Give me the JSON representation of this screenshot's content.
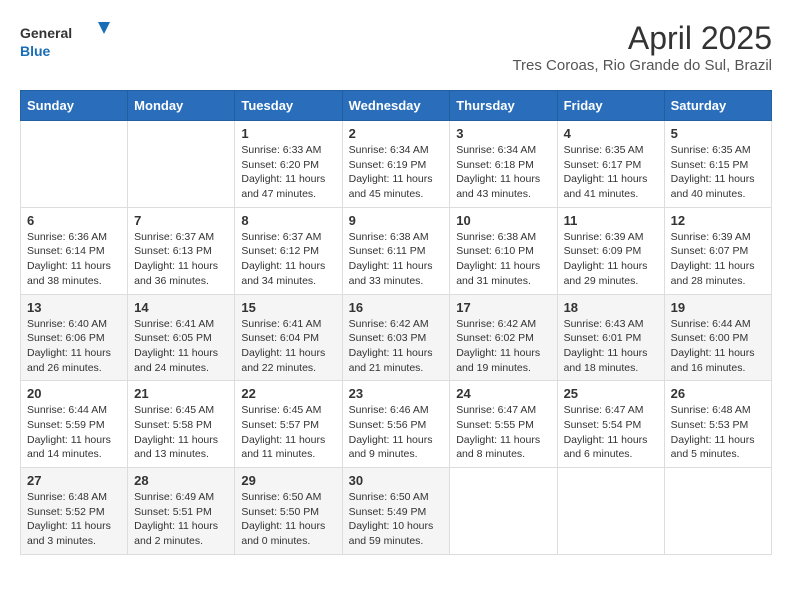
{
  "header": {
    "logo_general": "General",
    "logo_blue": "Blue",
    "month_title": "April 2025",
    "location": "Tres Coroas, Rio Grande do Sul, Brazil"
  },
  "calendar": {
    "days_of_week": [
      "Sunday",
      "Monday",
      "Tuesday",
      "Wednesday",
      "Thursday",
      "Friday",
      "Saturday"
    ],
    "weeks": [
      [
        {
          "day": "",
          "info": ""
        },
        {
          "day": "",
          "info": ""
        },
        {
          "day": "1",
          "info": "Sunrise: 6:33 AM\nSunset: 6:20 PM\nDaylight: 11 hours and 47 minutes."
        },
        {
          "day": "2",
          "info": "Sunrise: 6:34 AM\nSunset: 6:19 PM\nDaylight: 11 hours and 45 minutes."
        },
        {
          "day": "3",
          "info": "Sunrise: 6:34 AM\nSunset: 6:18 PM\nDaylight: 11 hours and 43 minutes."
        },
        {
          "day": "4",
          "info": "Sunrise: 6:35 AM\nSunset: 6:17 PM\nDaylight: 11 hours and 41 minutes."
        },
        {
          "day": "5",
          "info": "Sunrise: 6:35 AM\nSunset: 6:15 PM\nDaylight: 11 hours and 40 minutes."
        }
      ],
      [
        {
          "day": "6",
          "info": "Sunrise: 6:36 AM\nSunset: 6:14 PM\nDaylight: 11 hours and 38 minutes."
        },
        {
          "day": "7",
          "info": "Sunrise: 6:37 AM\nSunset: 6:13 PM\nDaylight: 11 hours and 36 minutes."
        },
        {
          "day": "8",
          "info": "Sunrise: 6:37 AM\nSunset: 6:12 PM\nDaylight: 11 hours and 34 minutes."
        },
        {
          "day": "9",
          "info": "Sunrise: 6:38 AM\nSunset: 6:11 PM\nDaylight: 11 hours and 33 minutes."
        },
        {
          "day": "10",
          "info": "Sunrise: 6:38 AM\nSunset: 6:10 PM\nDaylight: 11 hours and 31 minutes."
        },
        {
          "day": "11",
          "info": "Sunrise: 6:39 AM\nSunset: 6:09 PM\nDaylight: 11 hours and 29 minutes."
        },
        {
          "day": "12",
          "info": "Sunrise: 6:39 AM\nSunset: 6:07 PM\nDaylight: 11 hours and 28 minutes."
        }
      ],
      [
        {
          "day": "13",
          "info": "Sunrise: 6:40 AM\nSunset: 6:06 PM\nDaylight: 11 hours and 26 minutes."
        },
        {
          "day": "14",
          "info": "Sunrise: 6:41 AM\nSunset: 6:05 PM\nDaylight: 11 hours and 24 minutes."
        },
        {
          "day": "15",
          "info": "Sunrise: 6:41 AM\nSunset: 6:04 PM\nDaylight: 11 hours and 22 minutes."
        },
        {
          "day": "16",
          "info": "Sunrise: 6:42 AM\nSunset: 6:03 PM\nDaylight: 11 hours and 21 minutes."
        },
        {
          "day": "17",
          "info": "Sunrise: 6:42 AM\nSunset: 6:02 PM\nDaylight: 11 hours and 19 minutes."
        },
        {
          "day": "18",
          "info": "Sunrise: 6:43 AM\nSunset: 6:01 PM\nDaylight: 11 hours and 18 minutes."
        },
        {
          "day": "19",
          "info": "Sunrise: 6:44 AM\nSunset: 6:00 PM\nDaylight: 11 hours and 16 minutes."
        }
      ],
      [
        {
          "day": "20",
          "info": "Sunrise: 6:44 AM\nSunset: 5:59 PM\nDaylight: 11 hours and 14 minutes."
        },
        {
          "day": "21",
          "info": "Sunrise: 6:45 AM\nSunset: 5:58 PM\nDaylight: 11 hours and 13 minutes."
        },
        {
          "day": "22",
          "info": "Sunrise: 6:45 AM\nSunset: 5:57 PM\nDaylight: 11 hours and 11 minutes."
        },
        {
          "day": "23",
          "info": "Sunrise: 6:46 AM\nSunset: 5:56 PM\nDaylight: 11 hours and 9 minutes."
        },
        {
          "day": "24",
          "info": "Sunrise: 6:47 AM\nSunset: 5:55 PM\nDaylight: 11 hours and 8 minutes."
        },
        {
          "day": "25",
          "info": "Sunrise: 6:47 AM\nSunset: 5:54 PM\nDaylight: 11 hours and 6 minutes."
        },
        {
          "day": "26",
          "info": "Sunrise: 6:48 AM\nSunset: 5:53 PM\nDaylight: 11 hours and 5 minutes."
        }
      ],
      [
        {
          "day": "27",
          "info": "Sunrise: 6:48 AM\nSunset: 5:52 PM\nDaylight: 11 hours and 3 minutes."
        },
        {
          "day": "28",
          "info": "Sunrise: 6:49 AM\nSunset: 5:51 PM\nDaylight: 11 hours and 2 minutes."
        },
        {
          "day": "29",
          "info": "Sunrise: 6:50 AM\nSunset: 5:50 PM\nDaylight: 11 hours and 0 minutes."
        },
        {
          "day": "30",
          "info": "Sunrise: 6:50 AM\nSunset: 5:49 PM\nDaylight: 10 hours and 59 minutes."
        },
        {
          "day": "",
          "info": ""
        },
        {
          "day": "",
          "info": ""
        },
        {
          "day": "",
          "info": ""
        }
      ]
    ]
  }
}
